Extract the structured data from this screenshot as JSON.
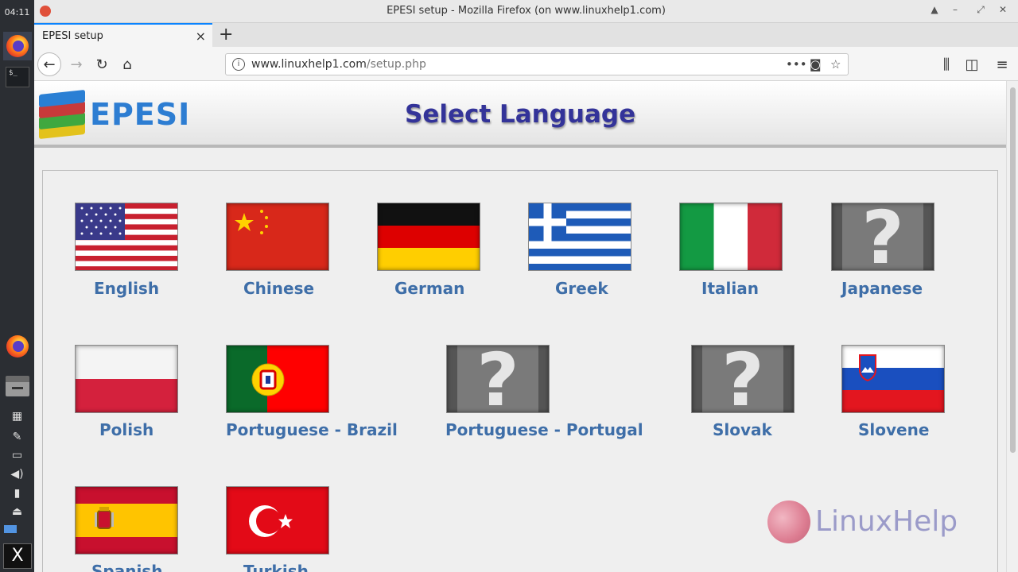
{
  "dock": {
    "clock": "04:11",
    "terminal_glyph": "$_",
    "bottom_glyph": "X"
  },
  "window": {
    "title": "EPESI setup - Mozilla Firefox (on www.linuxhelp1.com)"
  },
  "tab": {
    "label": "EPESI setup",
    "close": "×",
    "new_tab": "+"
  },
  "url": {
    "host": "www.linuxhelp1.com",
    "path": "/setup.php"
  },
  "page": {
    "brand": "EPESI",
    "heading": "Select Language"
  },
  "languages": [
    {
      "label": "English",
      "flag": "us"
    },
    {
      "label": "Chinese",
      "flag": "cn"
    },
    {
      "label": "German",
      "flag": "de"
    },
    {
      "label": "Greek",
      "flag": "gr"
    },
    {
      "label": "Italian",
      "flag": "it"
    },
    {
      "label": "Japanese",
      "flag": "unknown"
    },
    {
      "label": "Polish",
      "flag": "pl"
    },
    {
      "label": "Portuguese - Brazil",
      "flag": "pt"
    },
    {
      "label": "Portuguese - Portugal",
      "flag": "unknown"
    },
    {
      "label": "Slovak",
      "flag": "unknown"
    },
    {
      "label": "Slovene",
      "flag": "si"
    },
    {
      "label": "Spanish",
      "flag": "es"
    },
    {
      "label": "Turkish",
      "flag": "tr"
    }
  ],
  "unknown_flag_glyph": "?",
  "watermark": {
    "text": "LinuxHelp"
  },
  "colors": {
    "label": "#3e6ea8",
    "heading": "#333399",
    "accent": "#0a84ff"
  }
}
